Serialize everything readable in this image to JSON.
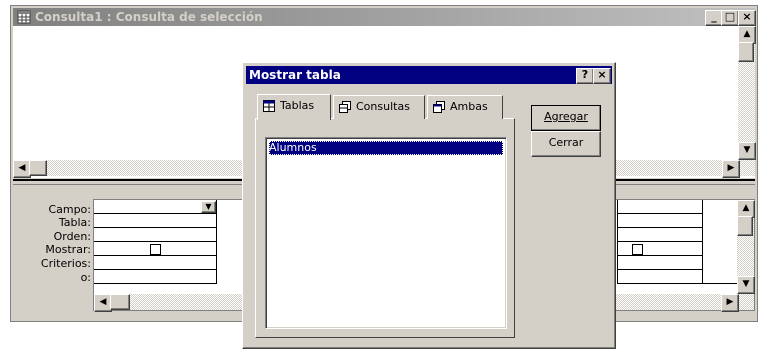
{
  "query_window": {
    "title": "Consulta1 : Consulta de selección",
    "controls": {
      "minimize": "_",
      "maximize": "□",
      "close": "×"
    }
  },
  "grid": {
    "row_labels": [
      "Campo:",
      "Tabla:",
      "Orden:",
      "Mostrar:",
      "Criterios:",
      "o:"
    ]
  },
  "dialog": {
    "title": "Mostrar tabla",
    "help": "?",
    "close": "×",
    "tabs": [
      {
        "label": "Tablas",
        "icon": "table-icon"
      },
      {
        "label": "Consultas",
        "icon": "query-icon"
      },
      {
        "label": "Ambas",
        "icon": "both-icon"
      }
    ],
    "list_items": [
      "Alumnos"
    ],
    "buttons": {
      "add": "Agregar",
      "close": "Cerrar"
    }
  }
}
